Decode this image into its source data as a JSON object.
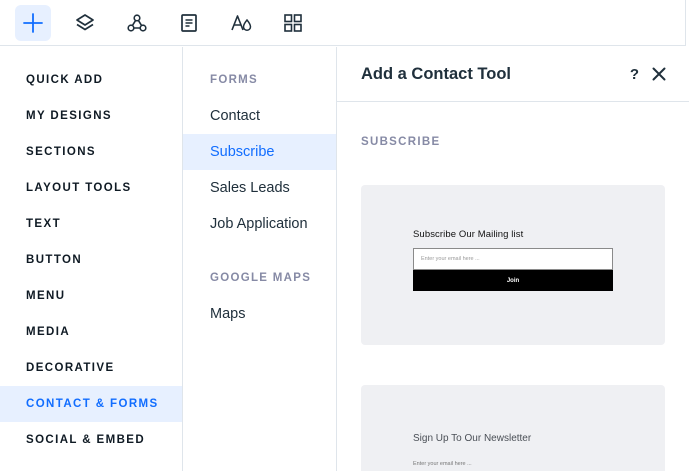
{
  "topbar": {
    "items": [
      {
        "name": "add-elements",
        "icon": "plus-icon"
      },
      {
        "name": "layers",
        "icon": "layers-icon"
      },
      {
        "name": "apps",
        "icon": "nodes-icon"
      },
      {
        "name": "pages",
        "icon": "page-icon"
      },
      {
        "name": "theme",
        "icon": "typography-icon"
      },
      {
        "name": "app-market",
        "icon": "grid-icon"
      }
    ]
  },
  "categories": [
    "QUICK ADD",
    "MY DESIGNS",
    "SECTIONS",
    "LAYOUT TOOLS",
    "TEXT",
    "BUTTON",
    "MENU",
    "MEDIA",
    "DECORATIVE",
    "CONTACT & FORMS",
    "SOCIAL & EMBED"
  ],
  "subcategories": {
    "forms_title": "FORMS",
    "forms": [
      "Contact",
      "Subscribe",
      "Sales Leads",
      "Job Application"
    ],
    "maps_title": "GOOGLE MAPS",
    "maps": [
      "Maps"
    ]
  },
  "panel": {
    "title": "Add a Contact Tool",
    "help_label": "?",
    "section_title": "SUBSCRIBE",
    "card1": {
      "title": "Subscribe Our Mailing list",
      "input_placeholder": "Enter your email here ...",
      "button_label": "Join"
    },
    "card2": {
      "title": "Sign Up To Our Newsletter",
      "input_placeholder": "Enter your email here ..."
    }
  },
  "colors": {
    "accent": "#116dff",
    "active_bg": "#e7f0ff",
    "muted_heading": "#868aa5",
    "card_bg": "#eff0f3"
  }
}
